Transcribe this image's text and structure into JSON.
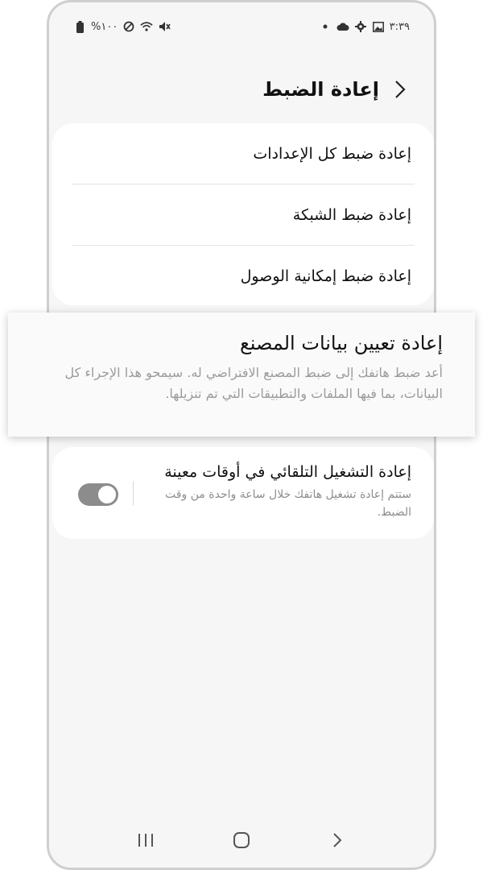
{
  "status_bar": {
    "time": "٣:٣٩",
    "battery_text": "%١٠٠",
    "right_icons": [
      "gallery-icon",
      "settings-gear-icon",
      "cloud-icon",
      "dot-icon"
    ],
    "left_icons": [
      "battery-icon",
      "do-not-disturb-icon",
      "wifi-icon",
      "mute-icon"
    ]
  },
  "header": {
    "title": "إعادة الضبط"
  },
  "reset_options": [
    {
      "label": "إعادة ضبط كل الإعدادات"
    },
    {
      "label": "إعادة ضبط الشبكة"
    },
    {
      "label": "إعادة ضبط إمكانية الوصول"
    }
  ],
  "factory_reset": {
    "title": "إعادة تعيين بيانات المصنع",
    "description": "أعد ضبط هاتفك إلى ضبط المصنع الافتراضي له. سيمحو هذا الإجراء كل البيانات، بما فيها الملفات والتطبيقات التي تم تنزيلها."
  },
  "auto_restart": {
    "title": "إعادة التشغيل التلقائي في أوقات معينة",
    "description": "ستتم إعادة تشغيل هاتفك خلال ساعة واحدة من وقت الضبط.",
    "enabled": true
  },
  "nav": {
    "icons": [
      "recents-icon",
      "home-icon",
      "back-icon"
    ]
  },
  "colors": {
    "background": "#f6f6f6",
    "card": "#ffffff",
    "toggle": "#8c8c8c"
  }
}
